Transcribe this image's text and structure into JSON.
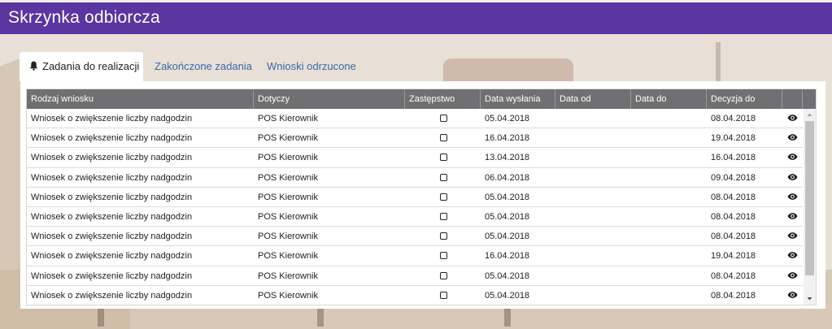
{
  "app": {
    "title": "Skrzynka odbiorcza"
  },
  "tabs": [
    {
      "label": "Zadania do realizacji",
      "active": true,
      "icon": "bell-icon"
    },
    {
      "label": "Zakończone zadania",
      "active": false
    },
    {
      "label": "Wnioski odrzucone",
      "active": false
    }
  ],
  "table": {
    "columns": [
      "Rodzaj wniosku",
      "Dotyczy",
      "Zastępstwo",
      "Data wysłania",
      "Data od",
      "Data do",
      "Decyzja do",
      ""
    ],
    "rows": [
      {
        "rodzaj": "Wniosek o zwiększenie liczby nadgodzin",
        "dotyczy": "POS Kierownik",
        "zastepstwo": false,
        "data_wyslania": "05.04.2018",
        "data_od": "",
        "data_do": "",
        "decyzja_do": "08.04.2018"
      },
      {
        "rodzaj": "Wniosek o zwiększenie liczby nadgodzin",
        "dotyczy": "POS Kierownik",
        "zastepstwo": false,
        "data_wyslania": "16.04.2018",
        "data_od": "",
        "data_do": "",
        "decyzja_do": "19.04.2018"
      },
      {
        "rodzaj": "Wniosek o zwiększenie liczby nadgodzin",
        "dotyczy": "POS Kierownik",
        "zastepstwo": false,
        "data_wyslania": "13.04.2018",
        "data_od": "",
        "data_do": "",
        "decyzja_do": "16.04.2018"
      },
      {
        "rodzaj": "Wniosek o zwiększenie liczby nadgodzin",
        "dotyczy": "POS Kierownik",
        "zastepstwo": false,
        "data_wyslania": "06.04.2018",
        "data_od": "",
        "data_do": "",
        "decyzja_do": "09.04.2018"
      },
      {
        "rodzaj": "Wniosek o zwiększenie liczby nadgodzin",
        "dotyczy": "POS Kierownik",
        "zastepstwo": false,
        "data_wyslania": "05.04.2018",
        "data_od": "",
        "data_do": "",
        "decyzja_do": "08.04.2018"
      },
      {
        "rodzaj": "Wniosek o zwiększenie liczby nadgodzin",
        "dotyczy": "POS Kierownik",
        "zastepstwo": false,
        "data_wyslania": "05.04.2018",
        "data_od": "",
        "data_do": "",
        "decyzja_do": "08.04.2018"
      },
      {
        "rodzaj": "Wniosek o zwiększenie liczby nadgodzin",
        "dotyczy": "POS Kierownik",
        "zastepstwo": false,
        "data_wyslania": "05.04.2018",
        "data_od": "",
        "data_do": "",
        "decyzja_do": "08.04.2018"
      },
      {
        "rodzaj": "Wniosek o zwiększenie liczby nadgodzin",
        "dotyczy": "POS Kierownik",
        "zastepstwo": false,
        "data_wyslania": "16.04.2018",
        "data_od": "",
        "data_do": "",
        "decyzja_do": "19.04.2018"
      },
      {
        "rodzaj": "Wniosek o zwiększenie liczby nadgodzin",
        "dotyczy": "POS Kierownik",
        "zastepstwo": false,
        "data_wyslania": "05.04.2018",
        "data_od": "",
        "data_do": "",
        "decyzja_do": "08.04.2018"
      },
      {
        "rodzaj": "Wniosek o zwiększenie liczby nadgodzin",
        "dotyczy": "POS Kierownik",
        "zastepstwo": false,
        "data_wyslania": "05.04.2018",
        "data_od": "",
        "data_do": "",
        "decyzja_do": "08.04.2018"
      }
    ]
  },
  "icons": {
    "row_action": "eye-icon",
    "checkbox": "checkbox-unchecked-icon"
  },
  "colors": {
    "header": "#5b35a0",
    "table_header": "#707072",
    "link": "#3c66b0"
  }
}
